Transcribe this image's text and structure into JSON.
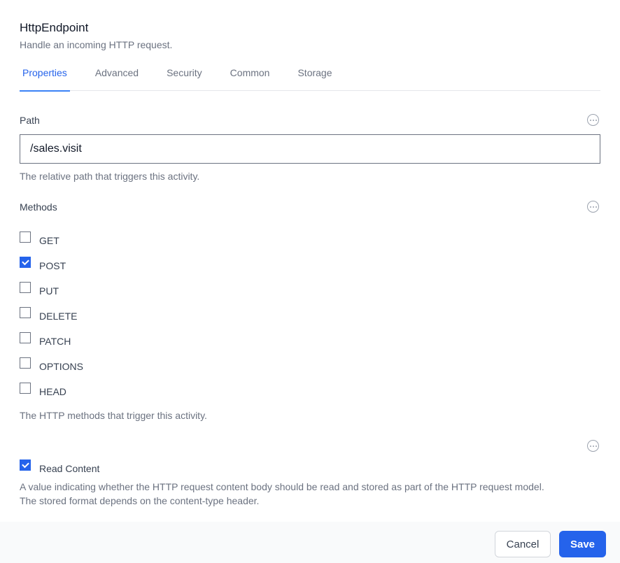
{
  "header": {
    "title": "HttpEndpoint",
    "subtitle": "Handle an incoming HTTP request."
  },
  "tabs": [
    {
      "label": "Properties",
      "active": true
    },
    {
      "label": "Advanced",
      "active": false
    },
    {
      "label": "Security",
      "active": false
    },
    {
      "label": "Common",
      "active": false
    },
    {
      "label": "Storage",
      "active": false
    }
  ],
  "path": {
    "label": "Path",
    "value": "/sales.visit",
    "hint": "The relative path that triggers this activity.",
    "menu_icon": "ellipsis-circle-icon"
  },
  "methods": {
    "label": "Methods",
    "menu_icon": "ellipsis-circle-icon",
    "options": [
      {
        "label": "GET",
        "checked": false
      },
      {
        "label": "POST",
        "checked": true
      },
      {
        "label": "PUT",
        "checked": false
      },
      {
        "label": "DELETE",
        "checked": false
      },
      {
        "label": "PATCH",
        "checked": false
      },
      {
        "label": "OPTIONS",
        "checked": false
      },
      {
        "label": "HEAD",
        "checked": false
      }
    ],
    "hint": "The HTTP methods that trigger this activity."
  },
  "read_content": {
    "label": "Read Content",
    "checked": true,
    "menu_icon": "ellipsis-circle-icon",
    "hint_line1": "A value indicating whether the HTTP request content body should be read and stored as part of the HTTP request model.",
    "hint_line2": "The stored format depends on the content-type header."
  },
  "footer": {
    "cancel_label": "Cancel",
    "save_label": "Save"
  },
  "colors": {
    "accent": "#2563eb",
    "footer_bg": "#f9fafb"
  }
}
